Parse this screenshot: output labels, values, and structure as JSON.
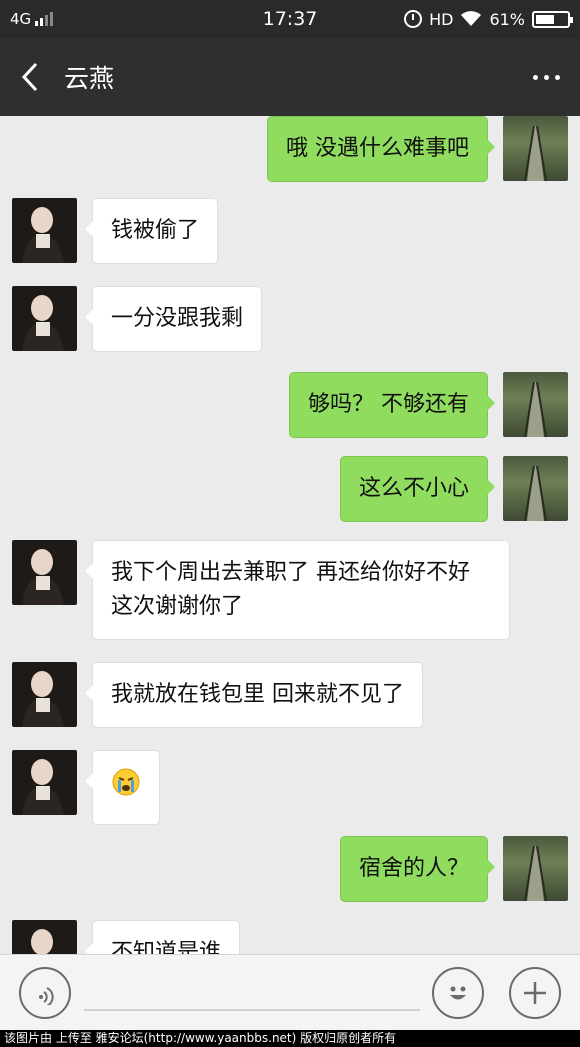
{
  "status_bar": {
    "network": "4G",
    "time": "17:37",
    "hd": "HD",
    "battery": "61%",
    "battery_level": 0.61
  },
  "header": {
    "title": "云燕"
  },
  "messages": [
    {
      "side": "right",
      "text": "哦  没遇什么难事吧"
    },
    {
      "side": "left",
      "text": "钱被偷了"
    },
    {
      "side": "left",
      "text": "一分没跟我剩"
    },
    {
      "side": "right",
      "text": "够吗？   不够还有"
    },
    {
      "side": "right",
      "text": "这么不小心"
    },
    {
      "side": "left",
      "text": "我下个周出去兼职了 再还给你好不好 这次谢谢你了"
    },
    {
      "side": "left",
      "text": "我就放在钱包里 回来就不见了"
    },
    {
      "side": "left",
      "emoji": "crying-face-emoji"
    },
    {
      "side": "right",
      "text": "宿舍的人？"
    },
    {
      "side": "left",
      "text": "不知道是谁"
    }
  ],
  "input_bar": {
    "icons": [
      "voice-icon",
      "emoji-icon",
      "plus-icon"
    ]
  },
  "footer": {
    "text": "该图片由  上传至 雅安论坛(http://www.yaanbbs.net) 版权归原创者所有"
  },
  "colors": {
    "sent_bubble": "#8fdc5e",
    "received_bubble": "#ffffff",
    "chat_background": "#ebebeb",
    "header_background": "#2f2f2f"
  }
}
